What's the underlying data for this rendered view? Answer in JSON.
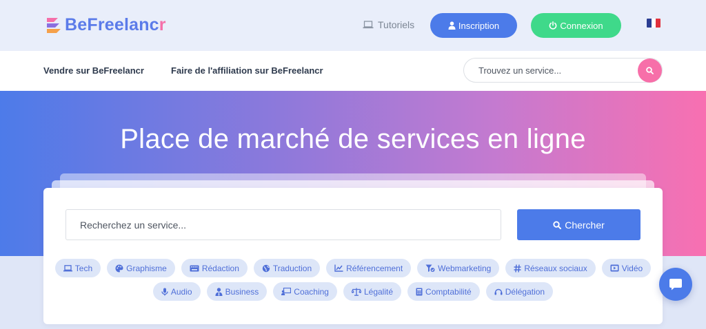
{
  "header": {
    "brand_main": "BeFreelanc",
    "brand_accent": "r",
    "tutorials_label": "Tutoriels",
    "signup_label": "Inscription",
    "login_label": "Connexion",
    "language": "FR"
  },
  "nav": {
    "links": [
      "Vendre sur BeFreelancr",
      "Faire de l'affiliation sur BeFreelancr"
    ],
    "search_placeholder": "Trouvez un service..."
  },
  "hero": {
    "title": "Place de marché de services en ligne"
  },
  "search": {
    "placeholder": "Recherchez un service...",
    "button_label": "Chercher"
  },
  "categories": [
    {
      "label": "Tech",
      "icon": "laptop-icon"
    },
    {
      "label": "Graphisme",
      "icon": "palette-icon"
    },
    {
      "label": "Rédaction",
      "icon": "keyboard-icon"
    },
    {
      "label": "Traduction",
      "icon": "globe-icon"
    },
    {
      "label": "Référencement",
      "icon": "chart-line-icon"
    },
    {
      "label": "Webmarketing",
      "icon": "funnel-icon"
    },
    {
      "label": "Réseaux sociaux",
      "icon": "hashtag-icon"
    },
    {
      "label": "Vidéo",
      "icon": "video-icon"
    },
    {
      "label": "Audio",
      "icon": "microphone-icon"
    },
    {
      "label": "Business",
      "icon": "user-tie-icon"
    },
    {
      "label": "Coaching",
      "icon": "chalkboard-teacher-icon"
    },
    {
      "label": "Légalité",
      "icon": "balance-scale-icon"
    },
    {
      "label": "Comptabilité",
      "icon": "calculator-icon"
    },
    {
      "label": "Délégation",
      "icon": "headset-icon"
    }
  ],
  "colors": {
    "primary": "#4c7be9",
    "accent_pink": "#f76fa9",
    "success": "#3fd98a",
    "chip_bg": "#dde6f8"
  }
}
